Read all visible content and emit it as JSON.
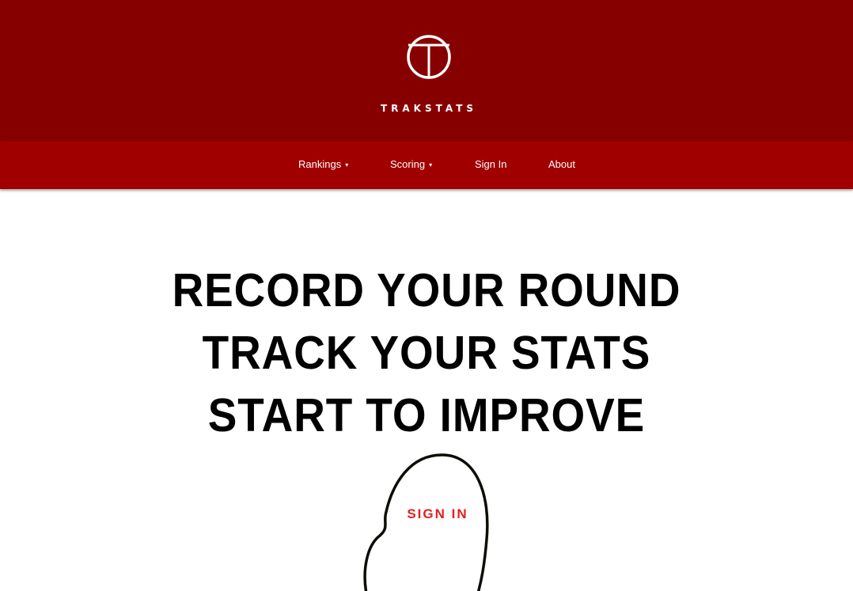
{
  "brand": {
    "name": "TRAKSTATS",
    "logo_icon": "t-circle-logo-icon",
    "header_color": "#870000",
    "nav_color": "#a10000"
  },
  "nav": {
    "rankings": "Rankings",
    "scoring": "Scoring",
    "sign_in": "Sign In",
    "about": "About",
    "dropdown_caret": "▾"
  },
  "hero": {
    "line1": "RECORD YOUR ROUND",
    "line2": "TRACK YOUR STATS",
    "line3": "START TO IMPROVE"
  },
  "cta": {
    "label": "SIGN IN",
    "color": "#e41f1f"
  }
}
